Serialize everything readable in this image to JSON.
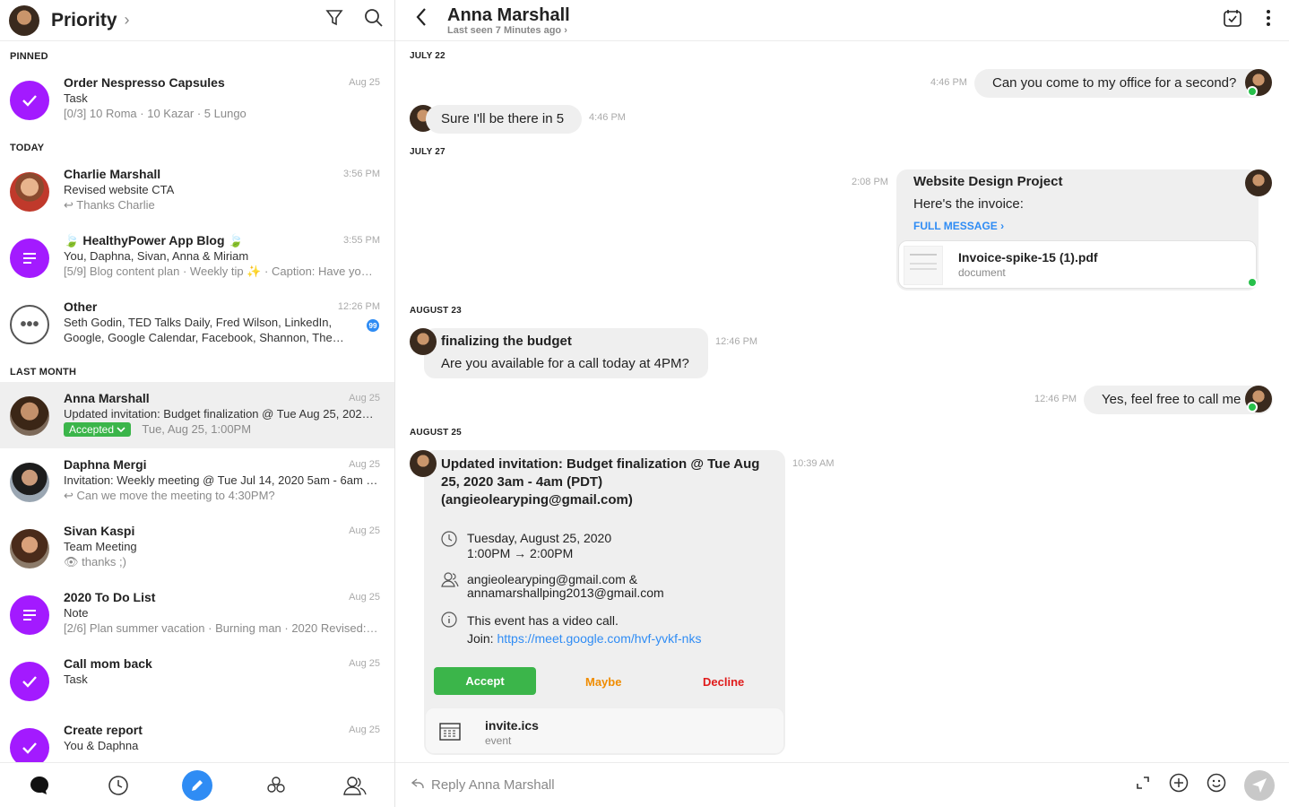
{
  "left": {
    "title": "Priority",
    "sections": {
      "pinned": "PINNED",
      "today": "TODAY",
      "last_month": "LAST MONTH"
    },
    "conversations": [
      {
        "name": "Order Nespresso Capsules",
        "line1": "Task",
        "line2": "[0/3] 10 Roma · 10 Kazar · 5 Lungo",
        "time": "Aug 25"
      },
      {
        "name": "Charlie Marshall",
        "line1": "Revised website CTA",
        "line2": "Thanks Charlie",
        "time": "3:56 PM"
      },
      {
        "name": "HealthyPower App Blog",
        "line1": "You, Daphna, Sivan, Anna & Miriam",
        "line2": "[5/9] Blog content plan · Weekly tip ✨ · Caption: Have yo…",
        "time": "3:55 PM"
      },
      {
        "name": "Other",
        "line1": "Seth Godin, TED Talks Daily, Fred Wilson, LinkedIn,",
        "line2": "Google, Google Calendar, Facebook, Shannon, The…",
        "time": "12:26 PM",
        "badge": "99"
      },
      {
        "name": "Anna Marshall",
        "line1": "Updated invitation: Budget finalization @ Tue Aug 25, 202…",
        "status": "Accepted",
        "line2": "Tue, Aug 25, 1:00PM",
        "time": "Aug 25"
      },
      {
        "name": "Daphna Mergi",
        "line1": "Invitation: Weekly meeting @ Tue Jul 14, 2020 5am - 6am (…",
        "line2": "Can we move the meeting to 4:30PM?",
        "time": "Aug 25"
      },
      {
        "name": "Sivan Kaspi",
        "line1": "Team Meeting",
        "line2": "thanks ;)",
        "time": "Aug 25"
      },
      {
        "name": "2020 To Do List",
        "line1": "Note",
        "line2": "[2/6] Plan summer vacation · Burning man · 2020 Revised:…",
        "time": "Aug 25"
      },
      {
        "name": "Call mom back",
        "line1": "Task",
        "time": "Aug 25"
      },
      {
        "name": "Create report",
        "line1": "You & Daphna",
        "time": "Aug 25"
      }
    ]
  },
  "chat": {
    "name": "Anna Marshall",
    "last_seen": "Last seen 7 Minutes ago",
    "dates": [
      "JULY 22",
      "JULY 27",
      "AUGUST 23",
      "AUGUST 25"
    ],
    "messages": {
      "m1": {
        "text": "Can you come to my office for a second?",
        "time": "4:46 PM"
      },
      "m2": {
        "text": "Sure I'll be there in 5",
        "time": "4:46 PM"
      },
      "m3": {
        "subject": "Website Design Project",
        "text": "Here's the invoice:",
        "full": "FULL MESSAGE",
        "file": "Invoice-spike-15 (1).pdf",
        "file_type": "document",
        "time": "2:08 PM"
      },
      "m4": {
        "subject": "finalizing the budget",
        "text": "Are you available for a call today at 4PM?",
        "time": "12:46 PM"
      },
      "m5": {
        "text": "Yes, feel free to call me",
        "time": "12:46 PM"
      },
      "m6": {
        "title": "Updated invitation: Budget finalization @ Tue Aug 25, 2020 3am - 4am (PDT) (angieolearyping@gmail.com)",
        "date": "Tuesday, August 25, 2020",
        "time_range": "1:00PM → 2:00PM",
        "guests1": "angieolearyping@gmail.com &",
        "guests2": "annamarshallping2013@gmail.com",
        "video": "This event has a video call.",
        "join": "Join:",
        "url": "https://meet.google.com/hvf-yvkf-nks",
        "accept": "Accept",
        "maybe": "Maybe",
        "decline": "Decline",
        "file": "invite.ics",
        "file_type": "event",
        "time": "10:39 AM"
      }
    },
    "reply_placeholder": "Reply Anna Marshall"
  },
  "colors": {
    "accent": "#2f8cf4",
    "purple": "#a31aff",
    "green": "#3bb54a",
    "maybe": "#f08c00",
    "decline": "#e01b1b"
  }
}
